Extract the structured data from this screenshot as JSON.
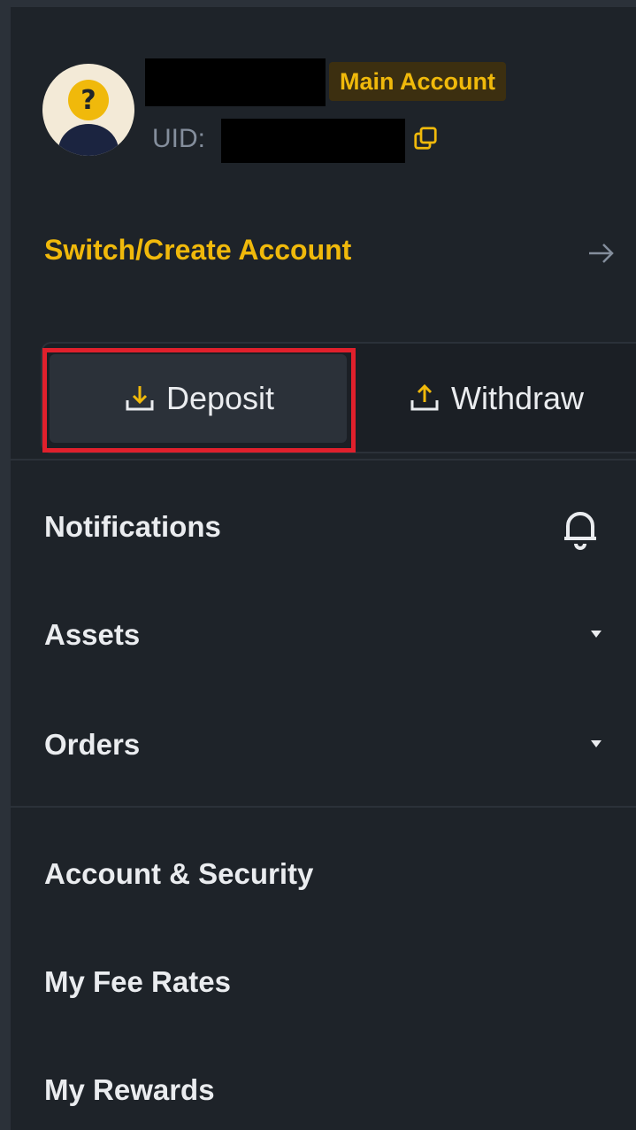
{
  "header": {
    "account_badge": "Main Account",
    "uid_label": "UID:",
    "icons": {
      "avatar": "avatar-question-mark",
      "copy": "copy-icon"
    }
  },
  "switch_account": {
    "label": "Switch/Create Account",
    "icon": "arrow-right-icon"
  },
  "actions": {
    "deposit_label": "Deposit",
    "withdraw_label": "Withdraw",
    "deposit_icon": "download-icon",
    "withdraw_icon": "upload-icon",
    "highlight_color": "#e0202c"
  },
  "menu": {
    "notifications": "Notifications",
    "assets": "Assets",
    "orders": "Orders",
    "account_security": "Account & Security",
    "fee_rates": "My Fee Rates",
    "rewards": "My Rewards"
  },
  "colors": {
    "accent": "#f0b90b",
    "background": "#1e2329",
    "text": "#eaecef",
    "muted": "#848e9c"
  }
}
